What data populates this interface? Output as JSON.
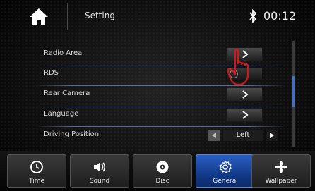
{
  "header": {
    "title": "Setting",
    "time": "00:12",
    "bluetooth_icon": "bluetooth-icon",
    "home_icon": "home-icon"
  },
  "settings": {
    "rows": [
      {
        "label": "Radio Area",
        "control": "chevron"
      },
      {
        "label": "RDS",
        "control": "toggle"
      },
      {
        "label": "Rear Camera",
        "control": "chevron"
      },
      {
        "label": "Language",
        "control": "chevron"
      },
      {
        "label": "Driving Position",
        "control": "selector",
        "value": "Left"
      }
    ]
  },
  "tabs": [
    {
      "label": "Time",
      "icon": "clock-icon",
      "active": false
    },
    {
      "label": "Sound",
      "icon": "speaker-icon",
      "active": false
    },
    {
      "label": "Disc",
      "icon": "disc-icon",
      "active": false
    },
    {
      "label": "General",
      "icon": "gear-icon",
      "active": true
    },
    {
      "label": "Wallpaper",
      "icon": "wallpaper-icon",
      "active": false
    }
  ],
  "colors": {
    "accent": "#2b5fc3",
    "hand_outline": "#d0181a"
  }
}
